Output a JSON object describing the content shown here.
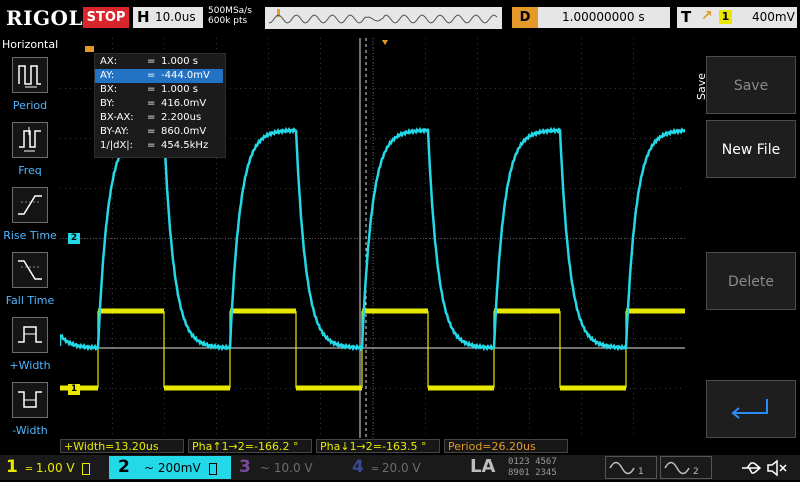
{
  "header": {
    "logo": "RIGOL",
    "run_state": "STOP",
    "timebase_label": "H",
    "timebase_value": "10.0us",
    "sample_rate": "500MSa/s",
    "memory_depth": "600k pts",
    "delay_label": "D",
    "delay_value": "1.00000000 s",
    "trigger_label": "T",
    "trigger_source": "1",
    "trigger_level": "400mV"
  },
  "left_menu": {
    "title": "Horizontal",
    "items": [
      {
        "label": "Period",
        "icon": "period-icon"
      },
      {
        "label": "Freq",
        "icon": "freq-icon"
      },
      {
        "label": "Rise Time",
        "icon": "rise-time-icon"
      },
      {
        "label": "Fall Time",
        "icon": "fall-time-icon"
      },
      {
        "label": "+Width",
        "icon": "positive-width-icon"
      },
      {
        "label": "-Width",
        "icon": "negative-width-icon"
      }
    ]
  },
  "cursor_table": {
    "rows": [
      {
        "key": "AX:",
        "eq": "=",
        "value": "1.000 s"
      },
      {
        "key": "AY:",
        "eq": "=",
        "value": "-444.0mV"
      },
      {
        "key": "BX:",
        "eq": "=",
        "value": "1.000 s"
      },
      {
        "key": "BY:",
        "eq": "=",
        "value": "416.0mV"
      },
      {
        "key": "BX-AX:",
        "eq": "=",
        "value": "2.200us"
      },
      {
        "key": "BY-AY:",
        "eq": "=",
        "value": "860.0mV"
      },
      {
        "key": "1/|dX|:",
        "eq": "=",
        "value": "454.5kHz"
      }
    ]
  },
  "markers": {
    "ch1": "1",
    "ch2": "2",
    "trigger": "T"
  },
  "right_panel": {
    "title": "Save",
    "buttons": [
      "Save",
      "New File",
      "Delete"
    ]
  },
  "measurements": {
    "width": "+Width=13.20us",
    "phase_rise": "Pha↑1→2=-166.2 °",
    "phase_fall": "Pha↓1→2=-163.5 °",
    "period": "Period=26.20us"
  },
  "bottom": {
    "ch1": {
      "num": "1",
      "coupling": "═",
      "scale": "1.00 V"
    },
    "ch2": {
      "num": "2",
      "coupling": "~",
      "scale": "200mV"
    },
    "ch3": {
      "num": "3",
      "coupling": "~",
      "scale": "10.0 V"
    },
    "ch4": {
      "num": "4",
      "coupling": "═",
      "scale": "20.0 V"
    },
    "la": "LA",
    "la_bits_top": "0123 4567",
    "la_bits_bottom": "8901 2345"
  },
  "colors": {
    "ch1": "#e9e900",
    "ch2": "#23d9e8",
    "trigger": "#e39a2a",
    "menu_label": "#4fb6ff",
    "stop": "#d8262c"
  }
}
